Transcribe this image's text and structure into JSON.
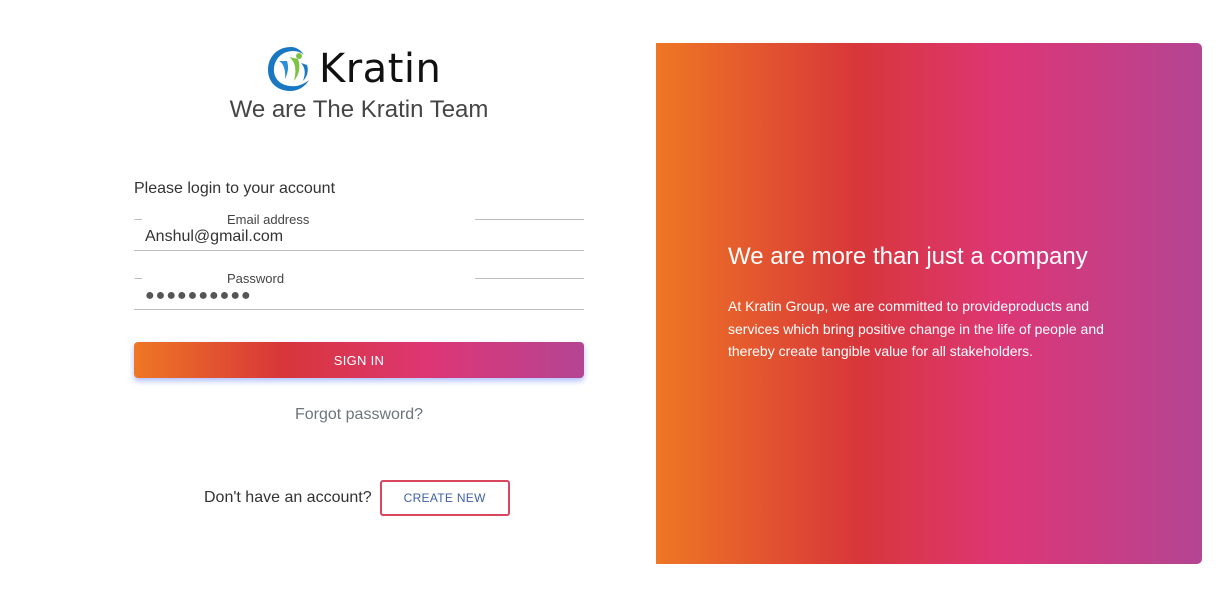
{
  "brand": {
    "logo_text": "Kratin",
    "logo_icon": "kratin-swirl-logo-icon"
  },
  "login_panel": {
    "team_title": "We are The Kratin Team",
    "prompt": "Please login to your account",
    "email": {
      "label": "Email address",
      "value": "Anshul@gmail.com"
    },
    "password": {
      "label": "Password",
      "value": "●●●●●●●●●●"
    },
    "signin_label": "SIGN IN",
    "forgot_label": "Forgot password?",
    "no_account_text": "Don't have an account?",
    "create_label": "CREATE NEW"
  },
  "promo_panel": {
    "headline": "We are more than just a company",
    "description": "At Kratin Group, we are committed to provideproducts and services which bring positive change in the life of people and thereby create tangible value for all stakeholders."
  },
  "colors": {
    "gradient": [
      "#ee7724",
      "#d8363a",
      "#dd3675",
      "#b44593"
    ],
    "create_border": "#d9475f",
    "create_text": "#3f61a8"
  }
}
